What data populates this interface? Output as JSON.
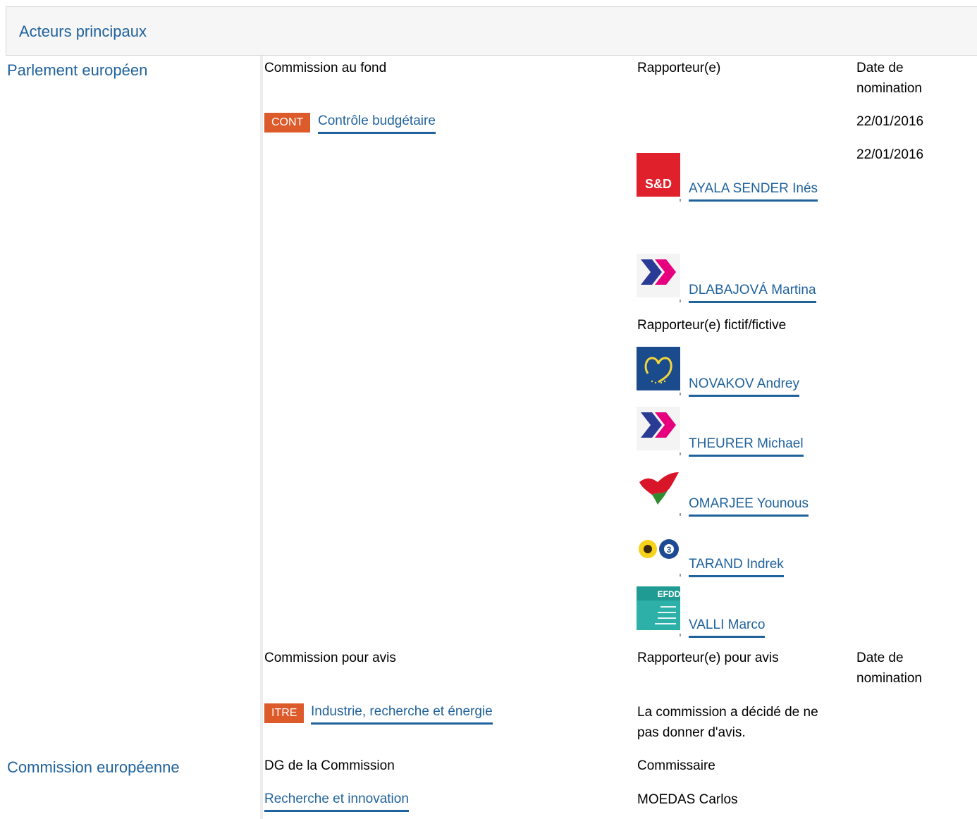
{
  "header": {
    "title": "Acteurs principaux"
  },
  "sections": {
    "ep": {
      "title": "Parlement européen"
    },
    "ec": {
      "title": "Commission européenne"
    }
  },
  "lead": {
    "col_committee": "Commission au fond",
    "col_rapporteur": "Rapporteur(e)",
    "col_date_line1": "Date de",
    "col_date_line2": "nomination",
    "committee_badge": "CONT",
    "committee_name": "Contrôle budgétaire",
    "committee_date": "22/01/2016",
    "rapporteur_date": "22/01/2016",
    "rapporteurs": [
      {
        "name": "AYALA SENDER Inés",
        "group_icon": "s-and-d-logo"
      },
      {
        "name": "DLABAJOVÁ Martina",
        "group_icon": "alde-logo"
      }
    ],
    "shadow_label": "Rapporteur(e) fictif/fictive",
    "shadows": [
      {
        "name": "NOVAKOV Andrey",
        "group_icon": "epp-logo"
      },
      {
        "name": "THEURER Michael",
        "group_icon": "alde-logo"
      },
      {
        "name": "OMARJEE Younous",
        "group_icon": "gue-ngl-logo"
      },
      {
        "name": "TARAND Indrek",
        "group_icon": "greens-efa-logo"
      },
      {
        "name": "VALLI Marco",
        "group_icon": "efdd-logo"
      }
    ]
  },
  "opinion": {
    "col_committee": "Commission pour avis",
    "col_rapporteur": "Rapporteur(e) pour avis",
    "col_date_line1": "Date de",
    "col_date_line2": "nomination",
    "committee_badge": "ITRE",
    "committee_name": "Industrie, recherche et énergie",
    "note_line1": "La commission a décidé de ne",
    "note_line2": "pas donner d'avis."
  },
  "commission": {
    "col_dg": "DG de la Commission",
    "col_commissioner": "Commissaire",
    "dg_name": "Recherche et innovation",
    "commissioner": "MOEDAS Carlos"
  },
  "colors": {
    "link": "#20629c",
    "badge": "#dd5a2b",
    "header_bg": "#f6f6f6"
  }
}
